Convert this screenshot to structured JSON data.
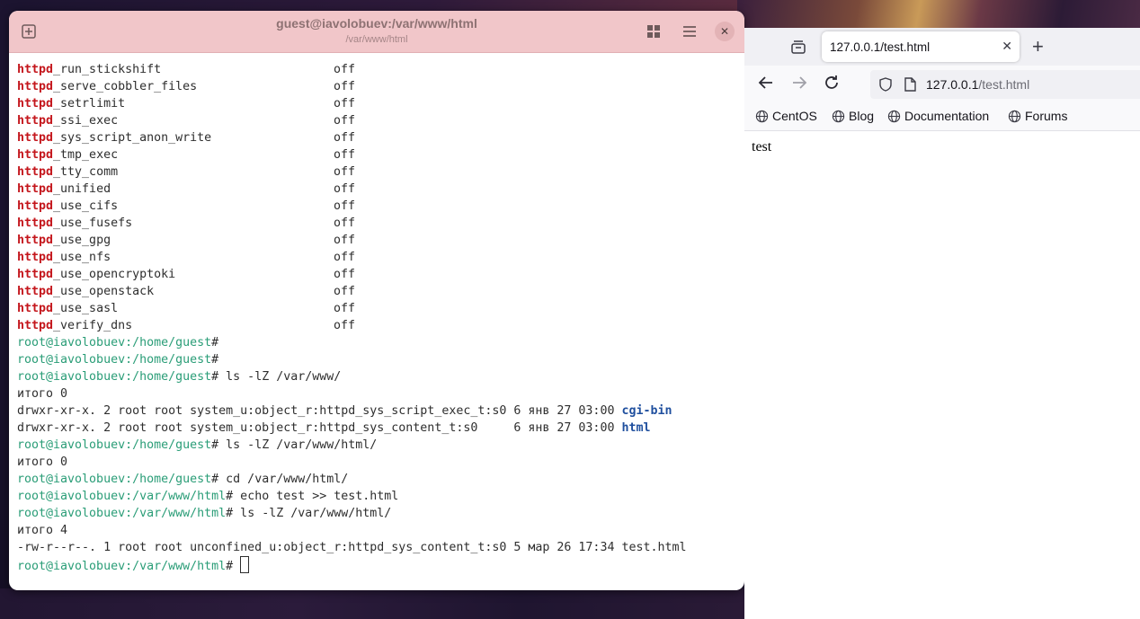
{
  "terminal": {
    "title": "guest@iavolobuev:/var/www/html",
    "subtitle": "/var/www/html",
    "booleans": [
      {
        "keyword": "httpd",
        "rest": "_run_stickshift",
        "value": "off"
      },
      {
        "keyword": "httpd",
        "rest": "_serve_cobbler_files",
        "value": "off"
      },
      {
        "keyword": "httpd",
        "rest": "_setrlimit",
        "value": "off"
      },
      {
        "keyword": "httpd",
        "rest": "_ssi_exec",
        "value": "off"
      },
      {
        "keyword": "httpd",
        "rest": "_sys_script_anon_write",
        "value": "off"
      },
      {
        "keyword": "httpd",
        "rest": "_tmp_exec",
        "value": "off"
      },
      {
        "keyword": "httpd",
        "rest": "_tty_comm",
        "value": "off"
      },
      {
        "keyword": "httpd",
        "rest": "_unified",
        "value": "off"
      },
      {
        "keyword": "httpd",
        "rest": "_use_cifs",
        "value": "off"
      },
      {
        "keyword": "httpd",
        "rest": "_use_fusefs",
        "value": "off"
      },
      {
        "keyword": "httpd",
        "rest": "_use_gpg",
        "value": "off"
      },
      {
        "keyword": "httpd",
        "rest": "_use_nfs",
        "value": "off"
      },
      {
        "keyword": "httpd",
        "rest": "_use_opencryptoki",
        "value": "off"
      },
      {
        "keyword": "httpd",
        "rest": "_use_openstack",
        "value": "off"
      },
      {
        "keyword": "httpd",
        "rest": "_use_sasl",
        "value": "off"
      },
      {
        "keyword": "httpd",
        "rest": "_verify_dns",
        "value": "off"
      }
    ],
    "lines": {
      "p1": "root@iavolobuev:/home/guest",
      "p2": "root@iavolobuev:/home/guest",
      "p3": "root@iavolobuev:/home/guest",
      "c3": "# ls -lZ /var/www/",
      "o1": "итого 0",
      "o2a": "drwxr-xr-x. 2 root root system_u:object_r:httpd_sys_script_exec_t:s0 6 янв 27 03:00 ",
      "o2b": "cgi-bin",
      "o3a": "drwxr-xr-x. 2 root root system_u:object_r:httpd_sys_content_t:s0     6 янв 27 03:00 ",
      "o3b": "html",
      "p4": "root@iavolobuev:/home/guest",
      "c4": "# ls -lZ /var/www/html/",
      "o4": "итого 0",
      "p5": "root@iavolobuev:/home/guest",
      "c5": "# cd /var/www/html/",
      "p6": "root@iavolobuev:/var/www/html",
      "c6": "# echo test >> test.html",
      "p7": "root@iavolobuev:/var/www/html",
      "c7": "# ls -lZ /var/www/html/",
      "o5": "итого 4",
      "o6": "-rw-r--r--. 1 root root unconfined_u:object_r:httpd_sys_content_t:s0 5 мар 26 17:34 test.html",
      "p8": "root@iavolobuev:/var/www/html",
      "c8": "# "
    }
  },
  "browser": {
    "tab_title": "127.0.0.1/test.html",
    "url_host": "127.0.0.1",
    "url_path": "/test.html",
    "bookmarks": [
      "CentOS",
      "Blog",
      "Documentation",
      "Forums"
    ],
    "page_text": "test"
  }
}
